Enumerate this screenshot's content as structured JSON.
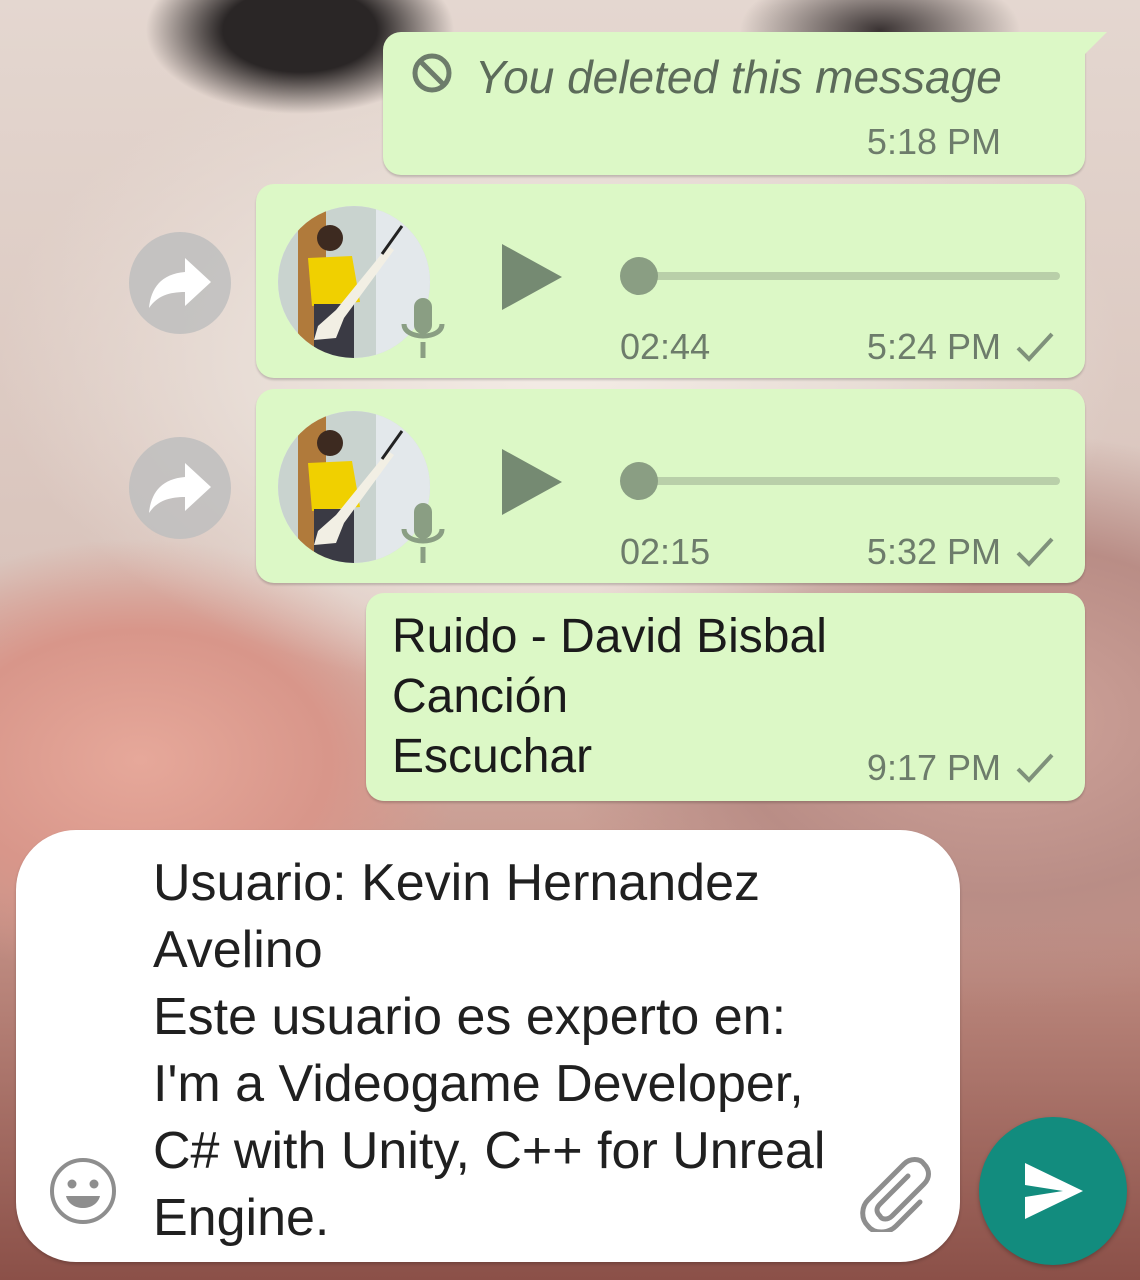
{
  "messages": {
    "deleted": {
      "text": "You deleted this message",
      "time": "5:18 PM",
      "icon": "ban-icon"
    },
    "voice_notes": [
      {
        "duration": "02:44",
        "time": "5:24 PM",
        "progress": 0.0,
        "status": "sent"
      },
      {
        "duration": "02:15",
        "time": "5:32 PM",
        "progress": 0.0,
        "status": "sent"
      }
    ],
    "song": {
      "lines": [
        "Ruido - David Bisbal",
        "Canción",
        "Escuchar"
      ],
      "time": "9:17 PM",
      "status": "sent"
    }
  },
  "composer": {
    "text": "Usuario: Kevin Hernandez Avelino\nEste usuario es experto en: I'm a Videogame Developer, C# with Unity, C++ for Unreal Engine."
  },
  "colors": {
    "outgoing_bubble": "#dcf8c6",
    "send_button": "#128c7e",
    "meta_text": "#6d7c6b"
  }
}
